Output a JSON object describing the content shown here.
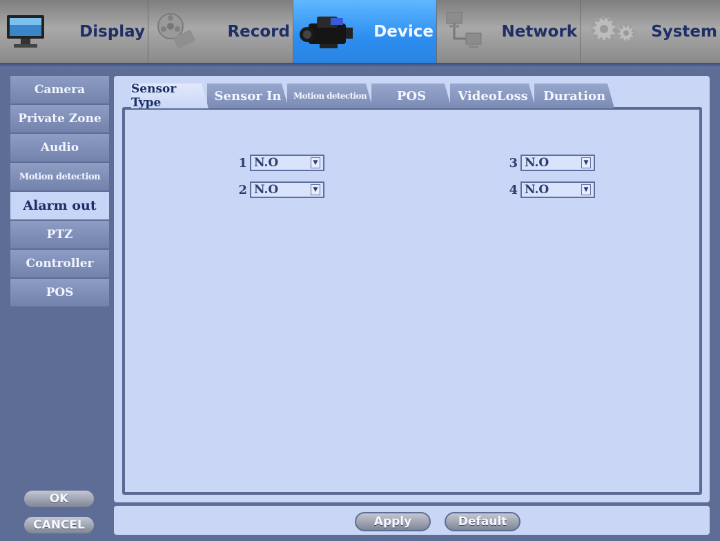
{
  "topnav": {
    "items": [
      {
        "label": "Display",
        "icon": "monitor-icon",
        "active": false
      },
      {
        "label": "Record",
        "icon": "film-reel-icon",
        "active": false
      },
      {
        "label": "Device",
        "icon": "camcorder-icon",
        "active": true
      },
      {
        "label": "Network",
        "icon": "network-icon",
        "active": false
      },
      {
        "label": "System",
        "icon": "gears-icon",
        "active": false
      }
    ]
  },
  "sidebar": {
    "items": [
      {
        "label": "Camera",
        "active": false
      },
      {
        "label": "Private Zone",
        "active": false
      },
      {
        "label": "Audio",
        "active": false
      },
      {
        "label": "Motion detection",
        "active": false
      },
      {
        "label": "Alarm out",
        "active": true
      },
      {
        "label": "PTZ",
        "active": false
      },
      {
        "label": "Controller",
        "active": false
      },
      {
        "label": "POS",
        "active": false
      }
    ]
  },
  "tabs": {
    "items": [
      {
        "label": "Sensor Type",
        "active": true
      },
      {
        "label": "Sensor In",
        "active": false
      },
      {
        "label": "Motion detection",
        "active": false
      },
      {
        "label": "POS",
        "active": false
      },
      {
        "label": "VideoLoss",
        "active": false
      },
      {
        "label": "Duration",
        "active": false
      }
    ]
  },
  "sensors": [
    {
      "number": "1",
      "value": "N.O"
    },
    {
      "number": "2",
      "value": "N.O"
    },
    {
      "number": "3",
      "value": "N.O"
    },
    {
      "number": "4",
      "value": "N.O"
    }
  ],
  "buttons": {
    "ok": "OK",
    "cancel": "CANCEL",
    "apply": "Apply",
    "default": "Default"
  },
  "colors": {
    "active_tab_blue": "#2c8ef0",
    "panel_bg": "#c9d6f6",
    "frame_bg": "#5d6d96"
  }
}
